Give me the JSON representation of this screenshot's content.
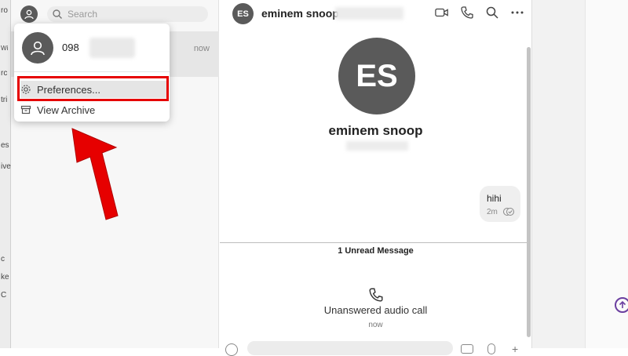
{
  "sidebar": {
    "search_placeholder": "Search",
    "conversation_time": "now",
    "background_fragments": [
      "ro",
      "Wi",
      "rc",
      "tri",
      "es",
      "ive",
      "c",
      "ke",
      "C"
    ]
  },
  "menu": {
    "user_number": "098",
    "preferences_label": "Preferences...",
    "archive_label": "View Archive"
  },
  "header": {
    "avatar_initials": "ES",
    "title": "eminem snoop ·"
  },
  "profile": {
    "avatar_initials": "ES",
    "name": "eminem snoop"
  },
  "message": {
    "text": "hihi",
    "age": "2m"
  },
  "unread_label": "1 Unread Message",
  "call": {
    "label": "Unanswered audio call",
    "time": "now"
  },
  "colors": {
    "highlight": "#e60000",
    "arrow": "#e60000",
    "avatar": "#5a5a5a"
  }
}
